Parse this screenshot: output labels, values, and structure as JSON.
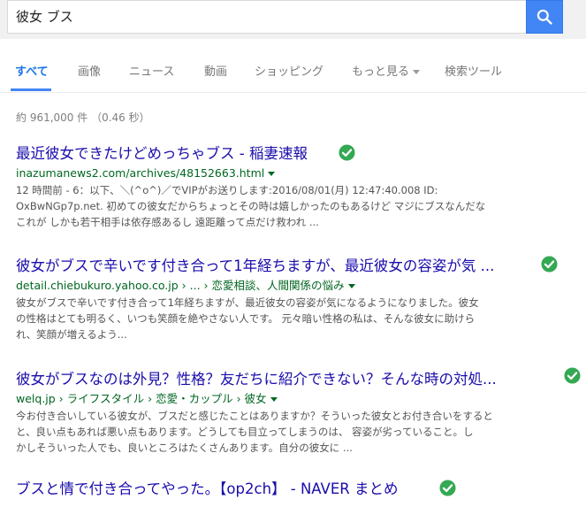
{
  "search": {
    "query": "彼女 ブス"
  },
  "tabs": [
    {
      "label": "すべて"
    },
    {
      "label": "画像"
    },
    {
      "label": "ニュース"
    },
    {
      "label": "動画"
    },
    {
      "label": "ショッピング"
    },
    {
      "label": "もっと見る"
    },
    {
      "label": "検索ツール"
    }
  ],
  "stats": "約 961,000 件 （0.46 秒）",
  "colors": {
    "accent": "#4285f4",
    "link": "#1a0dab",
    "url": "#006621",
    "check": "#34a853"
  },
  "results": [
    {
      "title": "最近彼女できたけどめっちゃブス - 稲妻速報",
      "url": "inazumanews2.com/archives/48152663.html",
      "snippet": "12 時間前 - 6：以下、＼(^o^)／でVIPがお送りします:2016/08/01(月) 12:47:40.008 ID:\nOxBwNGp7p.net. 初めての彼女だからちょっとその時は嬉しかったのもあるけど マジにブスなんだな\nこれが しかも若干相手は依存感あるし 遠距離って点だけ救われ ..."
    },
    {
      "title": "彼女がブスで辛いです付き合って1年経ちますが、最近彼女の容姿が気 ...",
      "url": "detail.chiebukuro.yahoo.co.jp › ... › 恋愛相談、人間関係の悩み",
      "snippet": "彼女がブスで辛いです付き合って1年経ちますが、最近彼女の容姿が気になるようになりました。彼女\nの性格はとても明るく、いつも笑顔を絶やさない人です。 元々暗い性格の私は、そんな彼女に助けら\nれ、笑顔が増えるよう..."
    },
    {
      "title": "彼女がブスなのは外見？性格？友だちに紹介できない？そんな時の対処...",
      "url": "welq.jp › ライフスタイル › 恋愛・カップル › 彼女",
      "snippet": "今お付き合いしている彼女が、ブスだと感じたことはありますか？そういった彼女とお付き合いをすると\nと、良い点もあれば悪い点もあります。どうしても目立ってしまうのは、 容姿が劣っていること。し\nかしそういった人でも、良いところはたくさんあります。自分の彼女に ..."
    },
    {
      "title": "ブスと情で付き合ってやった。【op2ch】 - NAVER まとめ"
    }
  ]
}
